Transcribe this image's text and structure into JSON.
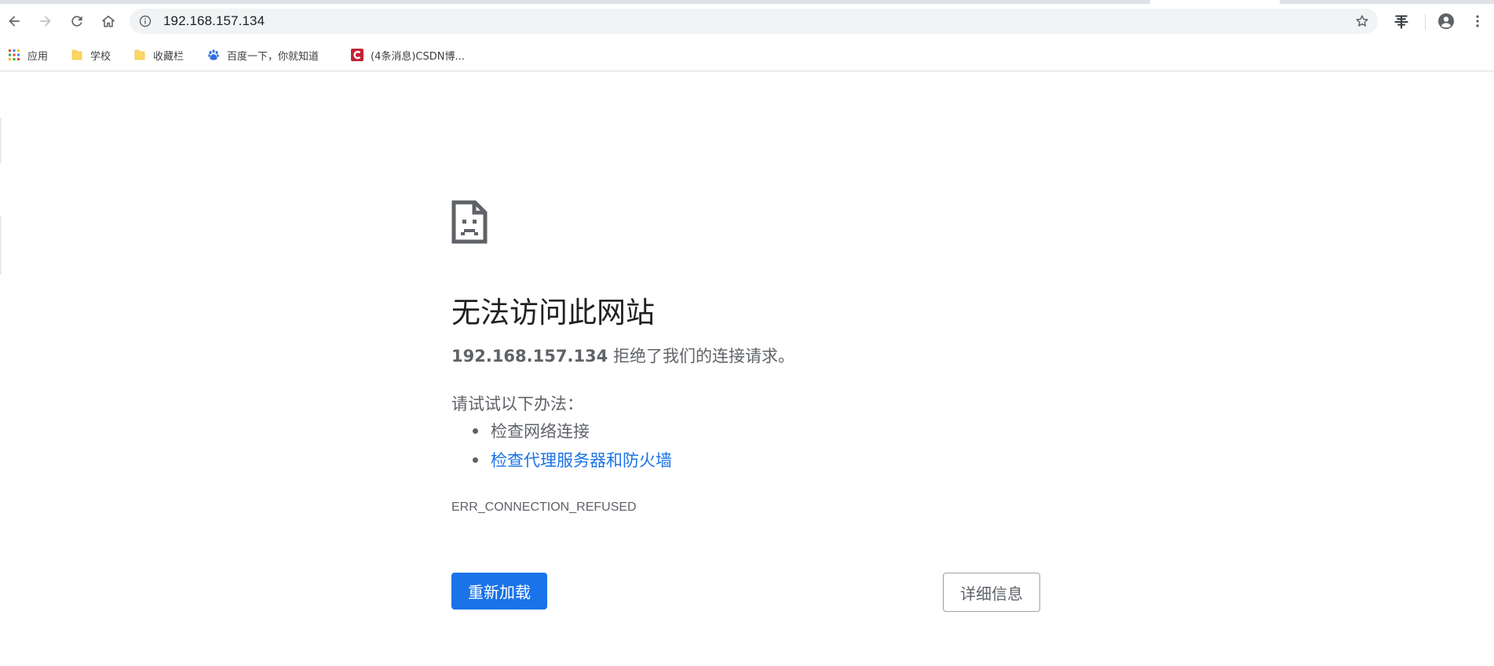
{
  "browser": {
    "address_bar": {
      "url": "192.168.157.134"
    },
    "colors": {
      "accent": "#1a73e8",
      "toolbar_icon": "#5f6368",
      "omnibox_bg": "#f1f3f4"
    }
  },
  "bookmarks": {
    "items": [
      {
        "label": "应用",
        "icon": "apps-grid-icon"
      },
      {
        "label": "学校",
        "icon": "folder-icon"
      },
      {
        "label": "收藏栏",
        "icon": "folder-icon"
      },
      {
        "label": "百度一下，你就知道",
        "icon": "baidu-paw-icon"
      },
      {
        "label": "(4条消息)CSDN博...",
        "icon": "csdn-icon"
      }
    ]
  },
  "error": {
    "icon": "sad-page-icon",
    "title": "无法访问此网站",
    "host": "192.168.157.134",
    "message": " 拒绝了我们的连接请求。",
    "suggestions_heading": "请试试以下办法：",
    "suggestions": [
      {
        "text": "检查网络连接"
      },
      {
        "text": "检查代理服务器和防火墙"
      }
    ],
    "code": "ERR_CONNECTION_REFUSED",
    "reload_label": "重新加载",
    "details_label": "详细信息"
  }
}
